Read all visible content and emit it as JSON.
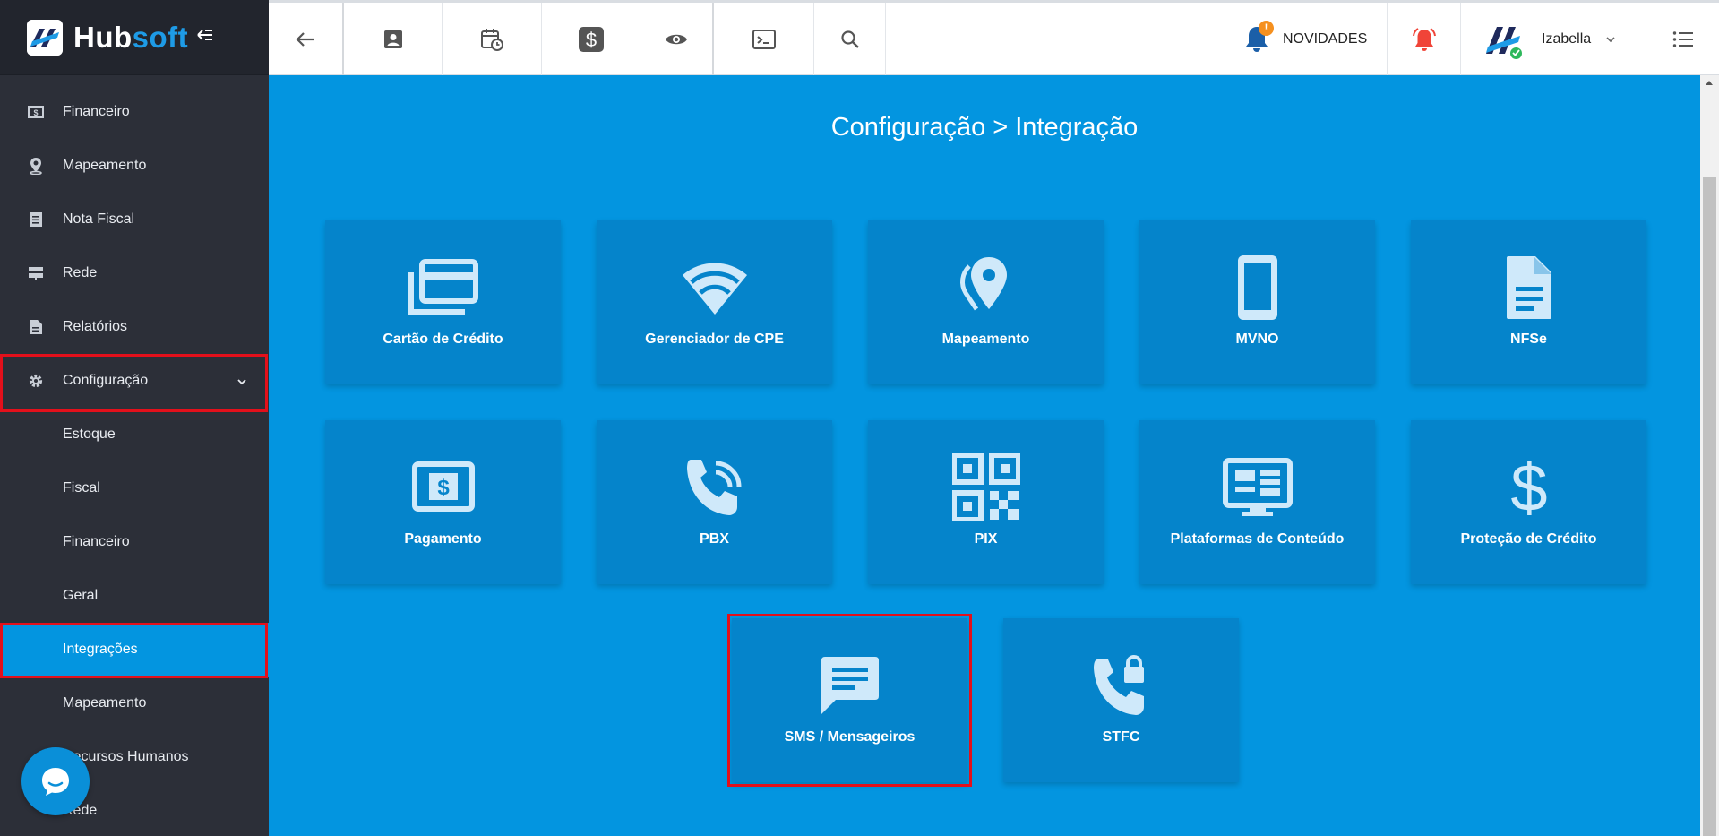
{
  "brand": {
    "name_part1": "Hub",
    "name_part2": "soft"
  },
  "sidebar": {
    "items": [
      {
        "label": "Financeiro",
        "icon": "money-icon"
      },
      {
        "label": "Mapeamento",
        "icon": "map-pin-icon"
      },
      {
        "label": "Nota Fiscal",
        "icon": "receipt-icon"
      },
      {
        "label": "Rede",
        "icon": "server-icon"
      },
      {
        "label": "Relatórios",
        "icon": "report-icon"
      },
      {
        "label": "Configuração",
        "icon": "gear-icon",
        "expanded": true
      }
    ],
    "subitems": [
      {
        "label": "Estoque"
      },
      {
        "label": "Fiscal"
      },
      {
        "label": "Financeiro"
      },
      {
        "label": "Geral"
      },
      {
        "label": "Integrações",
        "active": true
      },
      {
        "label": "Mapeamento"
      },
      {
        "label": "Recursos Humanos"
      },
      {
        "label": "Rede"
      }
    ]
  },
  "topbar": {
    "news_label": "NOVIDADES",
    "news_badge": "!",
    "user_name": "Izabella",
    "icons": [
      "back-arrow-icon",
      "contact-icon",
      "calendar-clock-icon",
      "dollar-icon",
      "eye-icon",
      "terminal-icon",
      "search-icon",
      "bell-icon",
      "alarm-icon",
      "list-icon"
    ]
  },
  "main": {
    "title": "Configuração > Integração",
    "tiles": [
      {
        "label": "Cartão de Crédito",
        "icon": "credit-card-icon"
      },
      {
        "label": "Gerenciador de CPE",
        "icon": "wifi-icon"
      },
      {
        "label": "Mapeamento",
        "icon": "map-pin-icon"
      },
      {
        "label": "MVNO",
        "icon": "smartphone-icon"
      },
      {
        "label": "NFSe",
        "icon": "document-icon"
      },
      {
        "label": "Pagamento",
        "icon": "cash-icon"
      },
      {
        "label": "PBX",
        "icon": "phone-ringing-icon"
      },
      {
        "label": "PIX",
        "icon": "qr-code-icon"
      },
      {
        "label": "Plataformas de Conteúdo",
        "icon": "dashboard-screen-icon"
      },
      {
        "label": "Proteção de Crédito",
        "icon": "dollar-icon"
      },
      {
        "label": "SMS / Mensageiros",
        "icon": "message-icon",
        "highlighted": true
      },
      {
        "label": "STFC",
        "icon": "phone-lock-icon"
      }
    ]
  },
  "colors": {
    "sidebar_bg": "#2c2f38",
    "accent": "#0395e0",
    "tile_bg": "#0584cb",
    "highlight_red": "#e3101b",
    "icon_light": "#cfe9fa"
  }
}
